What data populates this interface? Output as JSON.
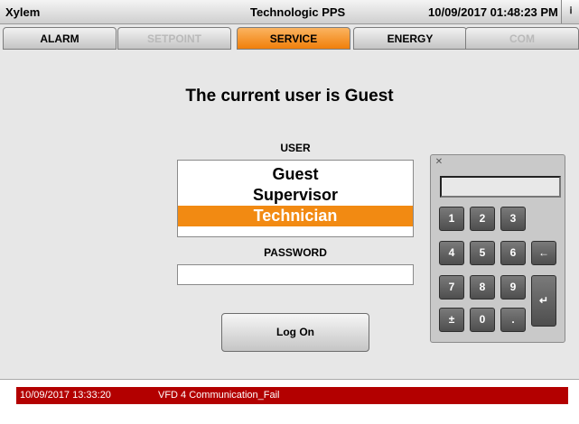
{
  "titlebar": {
    "brand": "Xylem",
    "app_title": "Technologic PPS",
    "clock": "10/09/2017 01:48:23 PM",
    "info_icon": "info-icon"
  },
  "tabs": [
    {
      "label": "ALARM",
      "state": "enabled"
    },
    {
      "label": "SETPOINT",
      "state": "disabled"
    },
    {
      "label": "SERVICE",
      "state": "active"
    },
    {
      "label": "ENERGY",
      "state": "enabled"
    },
    {
      "label": "COM",
      "state": "disabled"
    }
  ],
  "main": {
    "heading": "The current user is Guest",
    "user_label": "USER",
    "users": [
      "Guest",
      "Supervisor",
      "Technician"
    ],
    "selected_user": "Technician",
    "password_label": "PASSWORD",
    "password_value": "",
    "logon_label": "Log On"
  },
  "keypad": {
    "close_icon": "close-icon",
    "display": "",
    "keys": [
      "1",
      "2",
      "3",
      "4",
      "5",
      "6",
      "7",
      "8",
      "9",
      "±",
      "0",
      "."
    ],
    "backspace": "←",
    "enter": "↵"
  },
  "alarms": [
    {
      "time": "10/09/2017 13:33:20",
      "message": "VFD 4 Communication_Fail",
      "color": "#b30000"
    }
  ],
  "colors": {
    "accent": "#f28a12",
    "alarm": "#b30000",
    "background": "#e7e7e7"
  }
}
